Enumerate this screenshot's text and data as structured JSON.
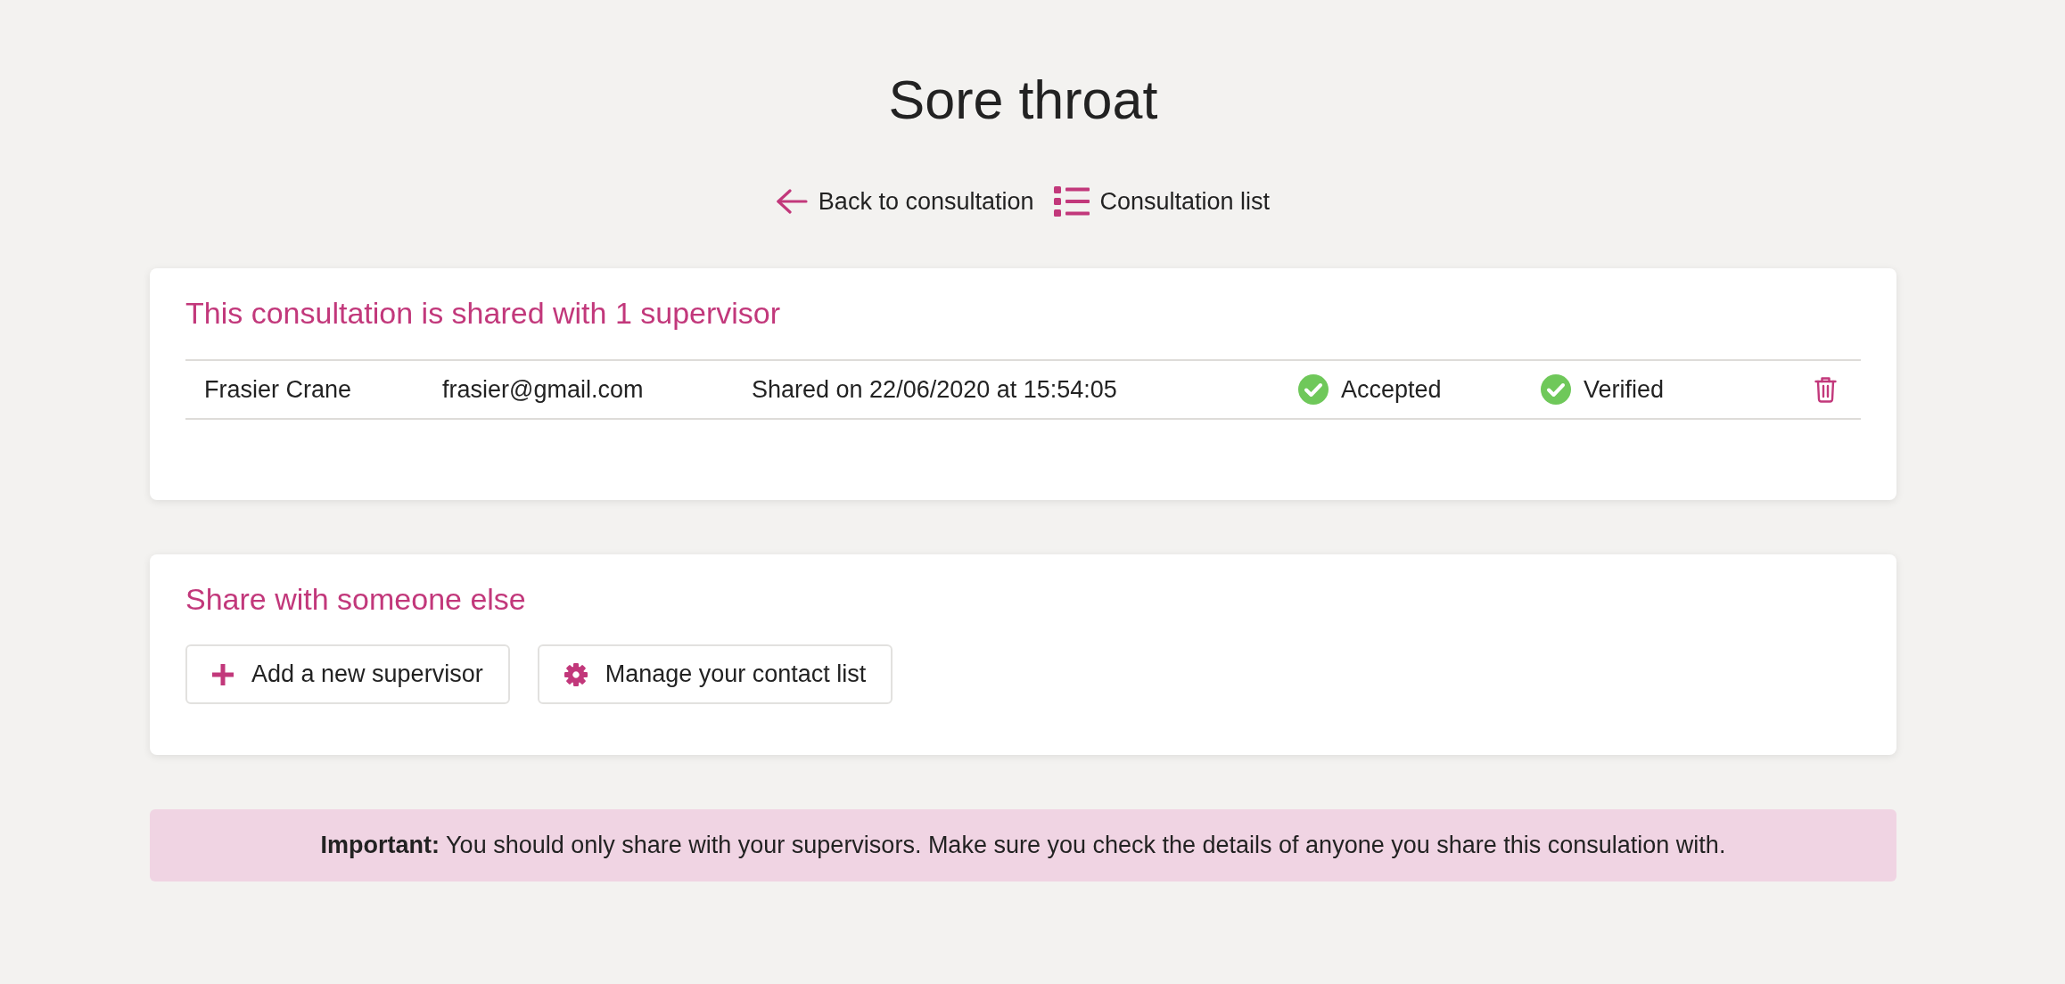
{
  "page": {
    "title": "Sore throat"
  },
  "nav_links": [
    {
      "kind": "back",
      "label": "Back to consultation"
    },
    {
      "kind": "list",
      "label": "Consultation list"
    }
  ],
  "shared_card": {
    "title": "This consultation is shared with 1 supervisor",
    "rows": [
      {
        "name": "Frasier Crane",
        "email": "frasier@gmail.com",
        "shared": "Shared on 22/06/2020 at 15:54:05",
        "statuses": [
          {
            "label": "Accepted",
            "done": true
          },
          {
            "label": "Verified",
            "done": true
          }
        ]
      }
    ]
  },
  "share_card": {
    "title": "Share with someone else",
    "buttons": [
      {
        "kind": "add",
        "label": "Add a new supervisor"
      },
      {
        "kind": "settings",
        "label": "Manage your contact list"
      }
    ]
  },
  "notice": {
    "text": "**Important:** You should only share with your supervisors. Make sure you check the details of anyone you share this consulation with."
  }
}
